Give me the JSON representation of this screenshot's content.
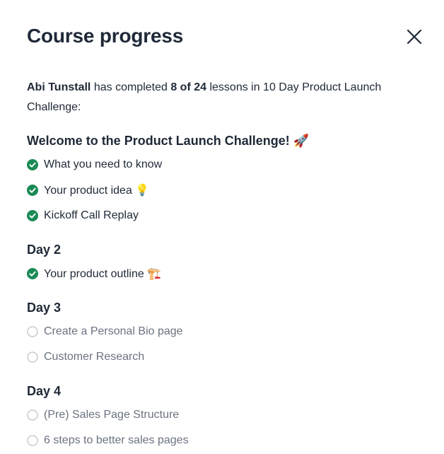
{
  "modal": {
    "title": "Course progress",
    "close_icon": "close-icon"
  },
  "summary": {
    "student_name": "Abi Tunstall",
    "text_before": " has completed ",
    "progress_text": "8 of 24",
    "text_after": " lessons in 10 Day Product Launch Challenge:",
    "completed": 8,
    "total": 24
  },
  "colors": {
    "complete": "#1a8a55",
    "incomplete": "#c9ccd1"
  },
  "sections": [
    {
      "title": "Welcome to the Product Launch Challenge! 🚀",
      "lessons": [
        {
          "label": "What you need to know",
          "status": "complete"
        },
        {
          "label": "Your product idea 💡",
          "status": "complete"
        },
        {
          "label": "Kickoff Call Replay",
          "status": "complete"
        }
      ]
    },
    {
      "title": "Day 2",
      "lessons": [
        {
          "label": "Your product outline 🏗️",
          "status": "complete"
        }
      ]
    },
    {
      "title": "Day 3",
      "lessons": [
        {
          "label": "Create a Personal Bio page",
          "status": "incomplete"
        },
        {
          "label": "Customer Research",
          "status": "incomplete"
        }
      ]
    },
    {
      "title": "Day 4",
      "lessons": [
        {
          "label": "(Pre) Sales Page Structure",
          "status": "incomplete"
        },
        {
          "label": "6 steps to better sales pages",
          "status": "incomplete"
        }
      ]
    }
  ]
}
